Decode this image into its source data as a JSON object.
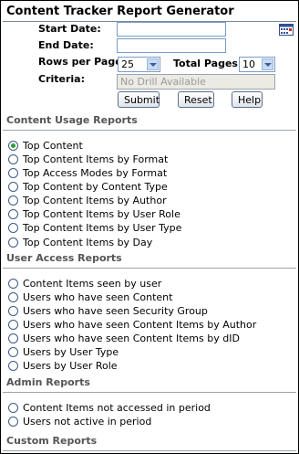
{
  "title": "Content Tracker Report Generator",
  "form": {
    "start_date_label": "Start Date:",
    "start_date_value": "",
    "end_date_label": "End Date:",
    "end_date_value": "",
    "rows_per_page_label": "Rows per Page:",
    "rows_per_page_value": "25",
    "total_pages_label": "Total Pages:",
    "total_pages_value": "10",
    "criteria_label": "Criteria:",
    "criteria_value": "No Drill Available",
    "submit_label": "Submit",
    "reset_label": "Reset",
    "help_label": "Help",
    "calendar_icon": "calendar-icon"
  },
  "sections": {
    "usage": {
      "title": "Content Usage Reports",
      "options": [
        {
          "label": "Top Content",
          "selected": true
        },
        {
          "label": "Top Content Items by Format",
          "selected": false
        },
        {
          "label": "Top Access Modes by Format",
          "selected": false
        },
        {
          "label": "Top Content by Content Type",
          "selected": false
        },
        {
          "label": "Top Content Items by Author",
          "selected": false
        },
        {
          "label": "Top Content Items by User Role",
          "selected": false
        },
        {
          "label": "Top Content Items by User Type",
          "selected": false
        },
        {
          "label": "Top Content Items by Day",
          "selected": false
        }
      ]
    },
    "user_access": {
      "title": "User Access Reports",
      "options": [
        {
          "label": "Content Items seen by user",
          "selected": false
        },
        {
          "label": "Users who have seen Content",
          "selected": false
        },
        {
          "label": "Users who have seen Security Group",
          "selected": false
        },
        {
          "label": "Users who have seen Content Items by Author",
          "selected": false
        },
        {
          "label": "Users who have seen Content Items by dID",
          "selected": false
        },
        {
          "label": "Users by User Type",
          "selected": false
        },
        {
          "label": "Users by User Role",
          "selected": false
        }
      ]
    },
    "admin": {
      "title": "Admin Reports",
      "options": [
        {
          "label": "Content Items not accessed in period",
          "selected": false
        },
        {
          "label": "Users not active in period",
          "selected": false
        }
      ]
    },
    "custom": {
      "title": "Custom Reports"
    }
  },
  "colors": {
    "selected_radio": "#2e9d33",
    "input_border": "#7a9cc9"
  }
}
